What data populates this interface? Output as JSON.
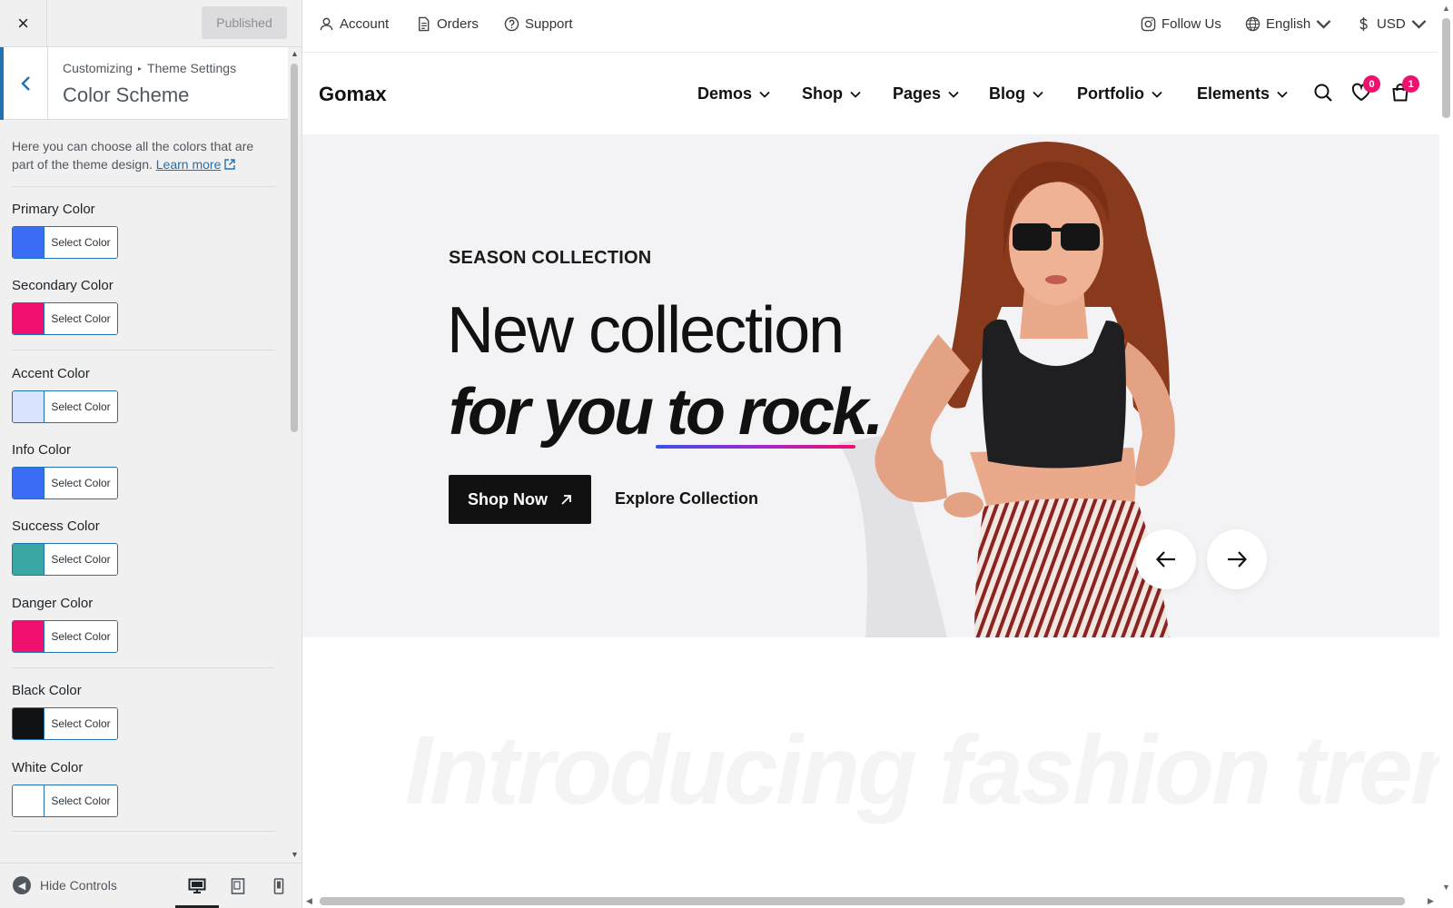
{
  "customizer": {
    "close_icon": "×",
    "publish_label": "Published",
    "breadcrumb_root": "Customizing",
    "breadcrumb_sep": "▸",
    "breadcrumb_parent": "Theme Settings",
    "section_title": "Color Scheme",
    "back_icon": "‹",
    "description": "Here you can choose all the colors that are part of the theme design.",
    "learn_more": "Learn more",
    "controls": [
      {
        "label": "Primary Color",
        "button": "Select Color",
        "color": "#3b6cf6"
      },
      {
        "label": "Secondary Color",
        "button": "Select Color",
        "color": "#f0106e"
      },
      {
        "label": "Accent Color",
        "button": "Select Color",
        "color": "#d9e3fd"
      },
      {
        "label": "Info Color",
        "button": "Select Color",
        "color": "#3b6cf6"
      },
      {
        "label": "Success Color",
        "button": "Select Color",
        "color": "#3aa6a3"
      },
      {
        "label": "Danger Color",
        "button": "Select Color",
        "color": "#f0106e"
      },
      {
        "label": "Black Color",
        "button": "Select Color",
        "color": "#111215"
      },
      {
        "label": "White Color",
        "button": "Select Color",
        "color": "#ffffff"
      }
    ],
    "footer": {
      "hide_controls": "Hide Controls",
      "devices": [
        "desktop-icon",
        "tablet-icon",
        "mobile-icon"
      ]
    }
  },
  "site": {
    "topbar": {
      "account": "Account",
      "orders": "Orders",
      "support": "Support",
      "follow": "Follow Us",
      "language": "English",
      "currency": "USD"
    },
    "logo": "Gomax",
    "nav": [
      "Demos",
      "Shop",
      "Pages",
      "Blog",
      "Portfolio",
      "Elements"
    ],
    "wishlist_count": "0",
    "cart_count": "1",
    "hero": {
      "eyebrow": "SEASON COLLECTION",
      "heading_line1": "New collection",
      "heading_line2": "for you to rock.",
      "shop_button": "Shop Now",
      "explore_link": "Explore Collection"
    },
    "ghost_heading": "Introducing fashion trend"
  },
  "colors": {
    "wp_blue": "#2271b1",
    "badge_pink": "#f0106e",
    "hero_bg": "#f3f3f5"
  }
}
